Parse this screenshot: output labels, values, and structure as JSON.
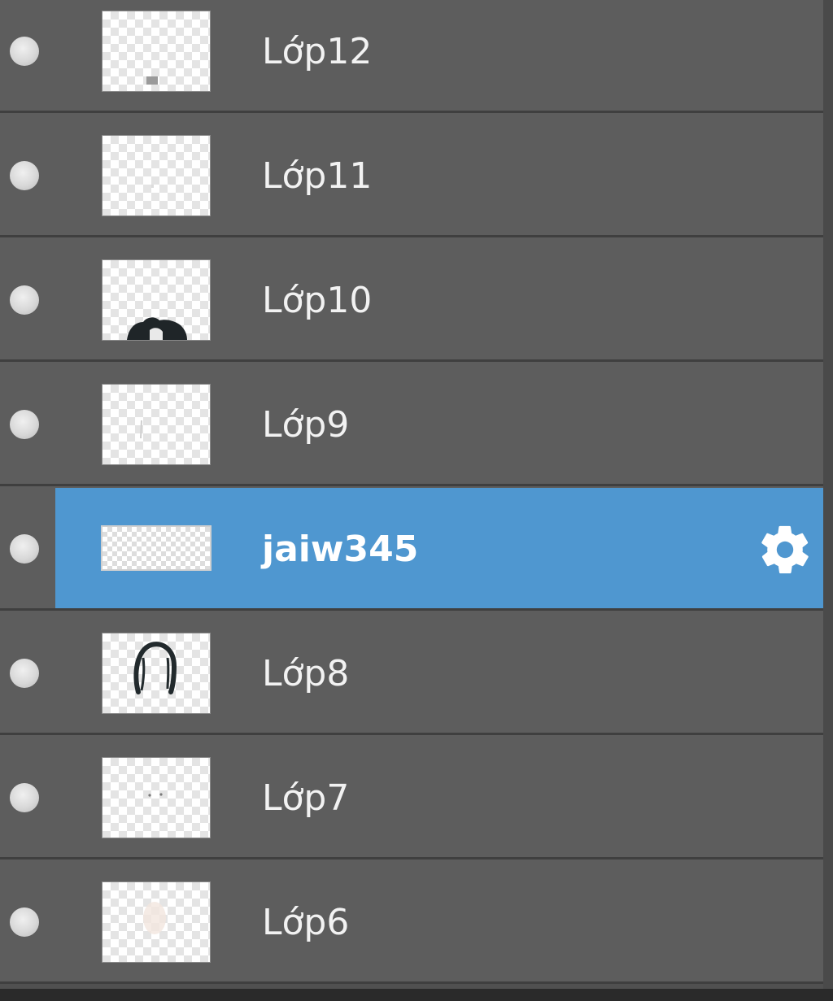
{
  "layers_panel": {
    "layers": [
      {
        "name": "Lớp12",
        "thumb_icon": "small-gray-mark-thumbnail",
        "selected": false
      },
      {
        "name": "Lớp11",
        "thumb_icon": "empty-thumbnail",
        "selected": false
      },
      {
        "name": "Lớp10",
        "thumb_icon": "dark-hair-top-thumbnail",
        "selected": false
      },
      {
        "name": "Lớp9",
        "thumb_icon": "faint-line-thumbnail",
        "selected": false
      },
      {
        "name": "jaiw345",
        "thumb_icon": "wide-image-thumbnail",
        "selected": true,
        "action_icon": "gear-icon"
      },
      {
        "name": "Lớp8",
        "thumb_icon": "hair-outline-thumbnail",
        "selected": false
      },
      {
        "name": "Lớp7",
        "thumb_icon": "tiny-dots-thumbnail",
        "selected": false
      },
      {
        "name": "Lớp6",
        "thumb_icon": "faint-skin-shape-thumbnail",
        "selected": false
      }
    ],
    "colors": {
      "row_background": "#5d5d5d",
      "row_separator": "#3f3f3f",
      "selected_highlight": "#4f97d0",
      "label_text": "#f2f2f2"
    }
  }
}
